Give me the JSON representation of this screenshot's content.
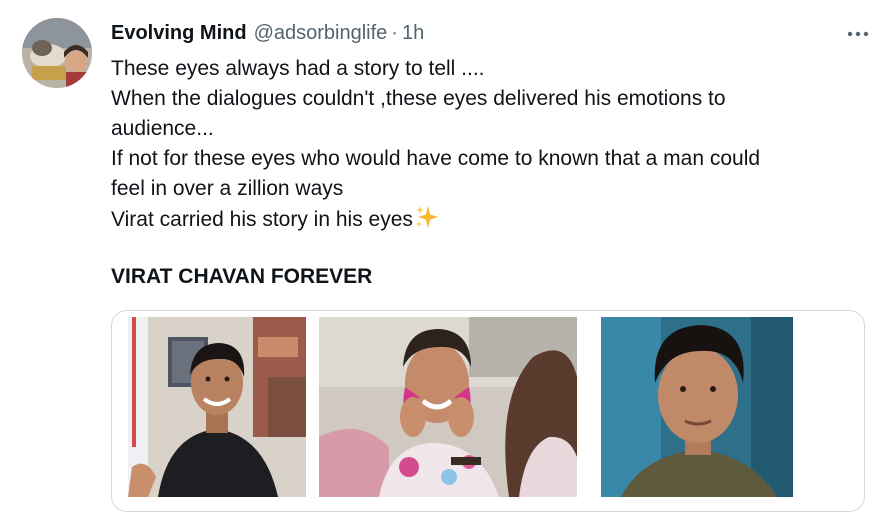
{
  "tweet": {
    "author_name": "Evolving Mind",
    "handle": "@adsorbinglife",
    "separator": "·",
    "time": "1h",
    "more_icon": "more-horizontal-icon",
    "lines": [
      "These eyes always had a story to tell ....",
      "When the dialogues couldn't ,these eyes delivered his emotions to",
      "audience...",
      "If not for these eyes who would have come to known that a man could",
      "feel in over a zillion ways",
      "Virat carried his story in his eyes"
    ],
    "emoji": "sparkles-emoji",
    "headline": "VIRAT CHAVAN FOREVER",
    "photos": [
      "smiling-man-photo",
      "holi-colours-photo",
      "man-closeup-photo"
    ]
  },
  "colors": {
    "text": "#0f1419",
    "secondary": "#536471",
    "border": "#cfd9de",
    "sparkle": "#f5b82e"
  }
}
